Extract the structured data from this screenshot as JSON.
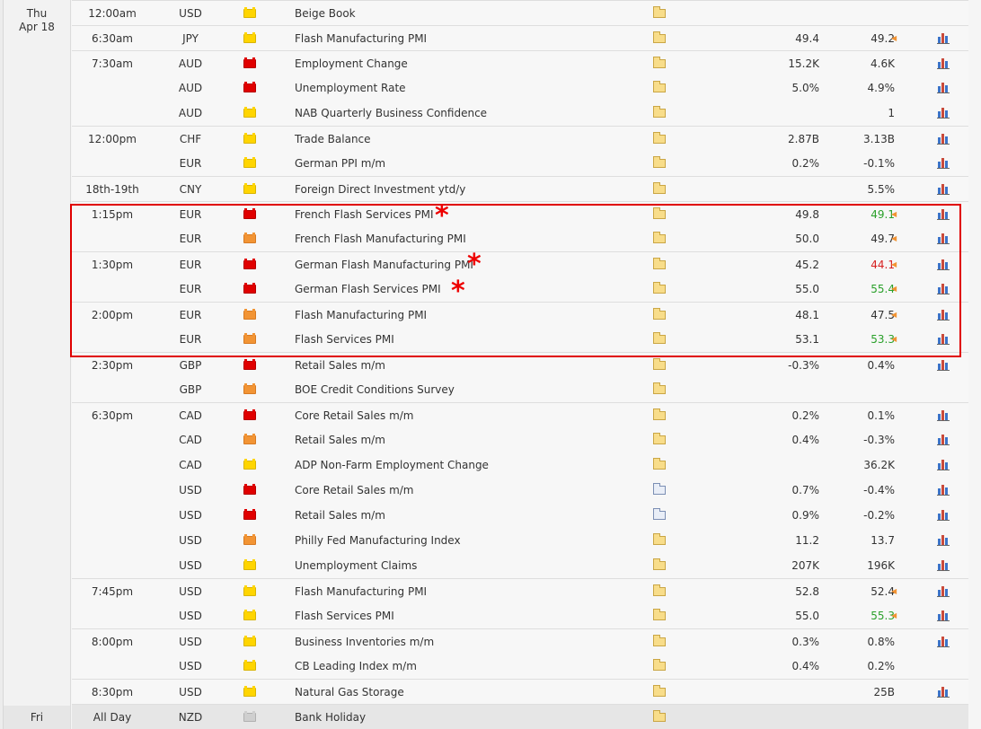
{
  "days": [
    {
      "day": "Thu",
      "date": "Apr 18"
    },
    {
      "day": "Fri",
      "date": ""
    }
  ],
  "rows": [
    {
      "time": "12:00am",
      "currency": "USD",
      "impact": "low",
      "event": "Beige Book",
      "detail": "folder",
      "actual": "",
      "forecast": "",
      "previous": "",
      "revised": false,
      "prev_color": "",
      "chart": false
    },
    {
      "time": "6:30am",
      "currency": "JPY",
      "impact": "low",
      "event": "Flash Manufacturing PMI",
      "detail": "folder",
      "actual": "49.4",
      "forecast": "49.2",
      "previous": "",
      "revised": true,
      "prev_color": "",
      "chart": true
    },
    {
      "time": "7:30am",
      "currency": "AUD",
      "impact": "high",
      "event": "Employment Change",
      "detail": "folder",
      "actual": "15.2K",
      "forecast": "4.6K",
      "previous": "",
      "revised": false,
      "prev_color": "",
      "chart": true
    },
    {
      "time": "",
      "currency": "AUD",
      "impact": "high",
      "event": "Unemployment Rate",
      "detail": "folder",
      "actual": "5.0%",
      "forecast": "4.9%",
      "previous": "",
      "revised": false,
      "prev_color": "",
      "chart": true
    },
    {
      "time": "",
      "currency": "AUD",
      "impact": "low",
      "event": "NAB Quarterly Business Confidence",
      "detail": "folder",
      "actual": "",
      "forecast": "1",
      "previous": "",
      "revised": false,
      "prev_color": "",
      "chart": true
    },
    {
      "time": "12:00pm",
      "currency": "CHF",
      "impact": "low",
      "event": "Trade Balance",
      "detail": "folder",
      "actual": "2.87B",
      "forecast": "3.13B",
      "previous": "",
      "revised": false,
      "prev_color": "",
      "chart": true
    },
    {
      "time": "",
      "currency": "EUR",
      "impact": "low",
      "event": "German PPI m/m",
      "detail": "folder",
      "actual": "0.2%",
      "forecast": "-0.1%",
      "previous": "",
      "revised": false,
      "prev_color": "",
      "chart": true
    },
    {
      "time": "18th-19th",
      "currency": "CNY",
      "impact": "low",
      "event": "Foreign Direct Investment ytd/y",
      "detail": "folder",
      "actual": "",
      "forecast": "5.5%",
      "previous": "",
      "revised": false,
      "prev_color": "",
      "chart": true
    },
    {
      "time": "1:15pm",
      "currency": "EUR",
      "impact": "high",
      "event": "French Flash Services PMI",
      "detail": "folder",
      "actual": "49.8",
      "forecast": "49.1",
      "previous": "",
      "revised": true,
      "prev_color": "green",
      "chart": true
    },
    {
      "time": "",
      "currency": "EUR",
      "impact": "med",
      "event": "French Flash Manufacturing PMI",
      "detail": "folder",
      "actual": "50.0",
      "forecast": "49.7",
      "previous": "",
      "revised": true,
      "prev_color": "",
      "chart": true
    },
    {
      "time": "1:30pm",
      "currency": "EUR",
      "impact": "high",
      "event": "German Flash Manufacturing PMI",
      "detail": "folder",
      "actual": "45.2",
      "forecast": "44.1",
      "previous": "",
      "revised": true,
      "prev_color": "red",
      "chart": true
    },
    {
      "time": "",
      "currency": "EUR",
      "impact": "high",
      "event": "German Flash Services PMI",
      "detail": "folder",
      "actual": "55.0",
      "forecast": "55.4",
      "previous": "",
      "revised": true,
      "prev_color": "green",
      "chart": true
    },
    {
      "time": "2:00pm",
      "currency": "EUR",
      "impact": "med",
      "event": "Flash Manufacturing PMI",
      "detail": "folder",
      "actual": "48.1",
      "forecast": "47.5",
      "previous": "",
      "revised": true,
      "prev_color": "",
      "chart": true
    },
    {
      "time": "",
      "currency": "EUR",
      "impact": "med",
      "event": "Flash Services PMI",
      "detail": "folder",
      "actual": "53.1",
      "forecast": "53.3",
      "previous": "",
      "revised": true,
      "prev_color": "green",
      "chart": true
    },
    {
      "time": "2:30pm",
      "currency": "GBP",
      "impact": "high",
      "event": "Retail Sales m/m",
      "detail": "folder",
      "actual": "-0.3%",
      "forecast": "0.4%",
      "previous": "",
      "revised": false,
      "prev_color": "",
      "chart": true
    },
    {
      "time": "",
      "currency": "GBP",
      "impact": "med",
      "event": "BOE Credit Conditions Survey",
      "detail": "folder",
      "actual": "",
      "forecast": "",
      "previous": "",
      "revised": false,
      "prev_color": "",
      "chart": false
    },
    {
      "time": "6:30pm",
      "currency": "CAD",
      "impact": "high",
      "event": "Core Retail Sales m/m",
      "detail": "folder",
      "actual": "0.2%",
      "forecast": "0.1%",
      "previous": "",
      "revised": false,
      "prev_color": "",
      "chart": true
    },
    {
      "time": "",
      "currency": "CAD",
      "impact": "med",
      "event": "Retail Sales m/m",
      "detail": "folder",
      "actual": "0.4%",
      "forecast": "-0.3%",
      "previous": "",
      "revised": false,
      "prev_color": "",
      "chart": true
    },
    {
      "time": "",
      "currency": "CAD",
      "impact": "low",
      "event": "ADP Non-Farm Employment Change",
      "detail": "folder",
      "actual": "",
      "forecast": "36.2K",
      "previous": "",
      "revised": false,
      "prev_color": "",
      "chart": true
    },
    {
      "time": "",
      "currency": "USD",
      "impact": "high",
      "event": "Core Retail Sales m/m",
      "detail": "doc",
      "actual": "0.7%",
      "forecast": "-0.4%",
      "previous": "",
      "revised": false,
      "prev_color": "",
      "chart": true
    },
    {
      "time": "",
      "currency": "USD",
      "impact": "high",
      "event": "Retail Sales m/m",
      "detail": "doc",
      "actual": "0.9%",
      "forecast": "-0.2%",
      "previous": "",
      "revised": false,
      "prev_color": "",
      "chart": true
    },
    {
      "time": "",
      "currency": "USD",
      "impact": "med",
      "event": "Philly Fed Manufacturing Index",
      "detail": "folder",
      "actual": "11.2",
      "forecast": "13.7",
      "previous": "",
      "revised": false,
      "prev_color": "",
      "chart": true
    },
    {
      "time": "",
      "currency": "USD",
      "impact": "low",
      "event": "Unemployment Claims",
      "detail": "folder",
      "actual": "207K",
      "forecast": "196K",
      "previous": "",
      "revised": false,
      "prev_color": "",
      "chart": true
    },
    {
      "time": "7:45pm",
      "currency": "USD",
      "impact": "low",
      "event": "Flash Manufacturing PMI",
      "detail": "folder",
      "actual": "52.8",
      "forecast": "52.4",
      "previous": "",
      "revised": true,
      "prev_color": "",
      "chart": true
    },
    {
      "time": "",
      "currency": "USD",
      "impact": "low",
      "event": "Flash Services PMI",
      "detail": "folder",
      "actual": "55.0",
      "forecast": "55.3",
      "previous": "",
      "revised": true,
      "prev_color": "green",
      "chart": true
    },
    {
      "time": "8:00pm",
      "currency": "USD",
      "impact": "low",
      "event": "Business Inventories m/m",
      "detail": "folder",
      "actual": "0.3%",
      "forecast": "0.8%",
      "previous": "",
      "revised": false,
      "prev_color": "",
      "chart": true
    },
    {
      "time": "",
      "currency": "USD",
      "impact": "low",
      "event": "CB Leading Index m/m",
      "detail": "folder",
      "actual": "0.4%",
      "forecast": "0.2%",
      "previous": "",
      "revised": false,
      "prev_color": "",
      "chart": false
    },
    {
      "time": "8:30pm",
      "currency": "USD",
      "impact": "low",
      "event": "Natural Gas Storage",
      "detail": "folder",
      "actual": "",
      "forecast": "25B",
      "previous": "",
      "revised": false,
      "prev_color": "",
      "chart": true
    },
    {
      "time": "All Day",
      "currency": "NZD",
      "impact": "none",
      "event": "Bank Holiday",
      "detail": "folder",
      "actual": "",
      "forecast": "",
      "previous": "",
      "revised": false,
      "prev_color": "",
      "chart": false
    }
  ],
  "colors": {
    "high": "#e00000",
    "medium": "#f29434",
    "low": "#ffd500",
    "better": "#2aa02a",
    "worse": "#d62020"
  },
  "icons": {
    "impact": "impact-flag-icon",
    "detail": "folder-icon",
    "chart": "bar-chart-icon",
    "revised": "revised-arrow-icon"
  }
}
